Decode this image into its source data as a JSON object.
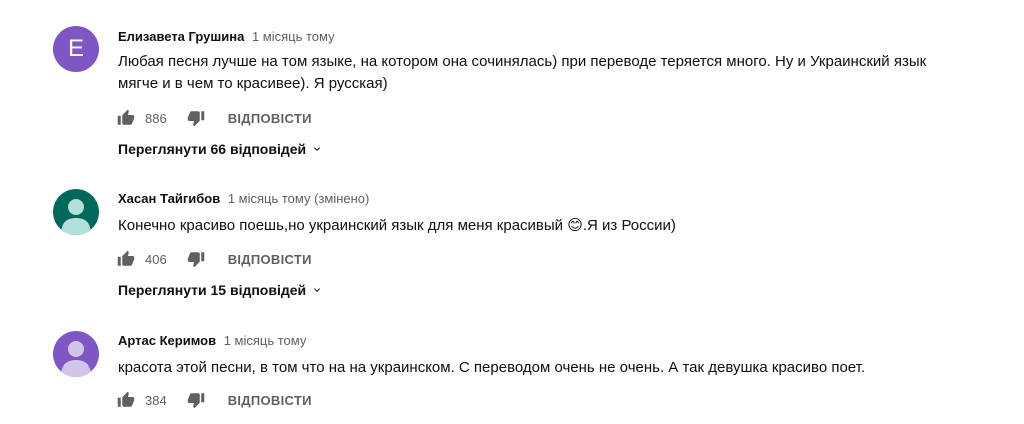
{
  "comments": [
    {
      "avatar_letter": "E",
      "avatar_color": "#7e57c2",
      "author": "Елизавета Грушина",
      "time": "1 місяць тому",
      "text_line1": "Любая песня лучше на том языке, на котором она сочинялась) при переводе теряется много. Ну и Украинский язык",
      "text_line2": "мягче и в чем то красивее). Я русская)",
      "likes": "886",
      "reply_label": "ВІДПОВІСТИ",
      "view_replies": "Переглянути 66 відповідей"
    },
    {
      "avatar_color": "#00695c",
      "author": "Хасан Тайгибов",
      "time": "1 місяць тому (змінено)",
      "text_line1": "Конечно красиво поешь,но украинский язык для меня красивый 😊.Я из России)",
      "likes": "406",
      "reply_label": "ВІДПОВІСТИ",
      "view_replies": "Переглянути 15 відповідей"
    },
    {
      "avatar_color": "#7e57c2",
      "author": "Артас Керимов",
      "time": "1 місяць тому",
      "text_line1": "красота этой песни, в том что на на украинском. С переводом очень не очень. А так девушка красиво поет.",
      "likes": "384",
      "reply_label": "ВІДПОВІСТИ"
    }
  ],
  "icons": {
    "like": "thumb-up-icon",
    "dislike": "thumb-down-icon",
    "expand": "chevron-down-icon"
  }
}
